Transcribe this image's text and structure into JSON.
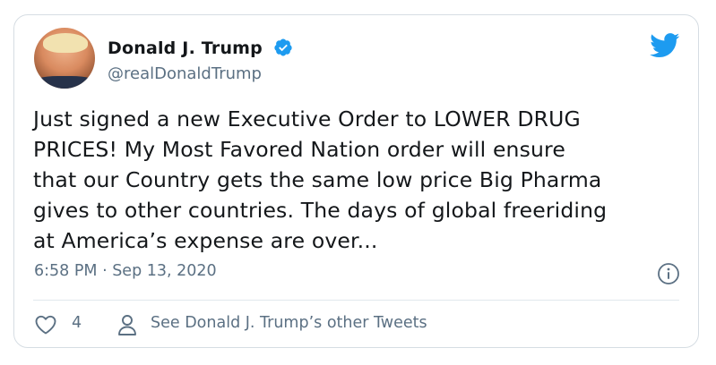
{
  "author": {
    "display_name": "Donald J. Trump",
    "handle": "@realDonaldTrump",
    "verified": true
  },
  "tweet": {
    "text": "Just signed a new Executive Order to LOWER DRUG\nPRICES! My Most Favored Nation order will ensure\nthat our Country gets the same low price Big Pharma\ngives to other countries. The days of global freeriding\nat America’s expense are over...",
    "timestamp": "6:58 PM · Sep 13, 2020"
  },
  "actions": {
    "like_count": "4",
    "other_tweets_label": "See Donald J. Trump’s other Tweets"
  },
  "icons": {
    "brand": "twitter-bird-icon",
    "verified": "verified-badge-icon",
    "info": "info-icon",
    "like": "heart-icon",
    "profile": "person-icon"
  },
  "colors": {
    "brand_blue": "#1d9bf0",
    "text": "#14171a",
    "muted": "#5b7083",
    "border": "#d6dde3"
  }
}
